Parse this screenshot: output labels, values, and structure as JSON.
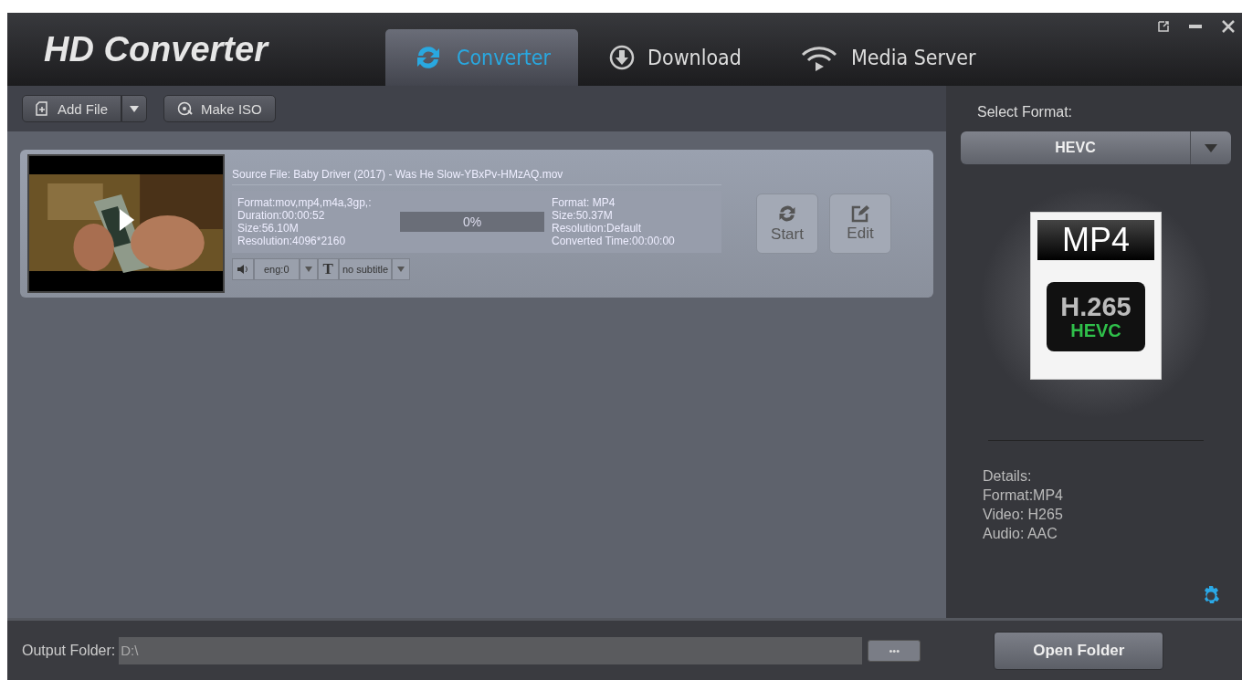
{
  "app": {
    "title": "HD Converter"
  },
  "tabs": [
    {
      "label": "Converter",
      "selected": true,
      "kind": "convert"
    },
    {
      "label": "Download",
      "selected": false,
      "kind": "download"
    },
    {
      "label": "Media Server",
      "selected": false,
      "kind": "server"
    }
  ],
  "toolbar": {
    "add_file": "Add File",
    "make_iso": "Make ISO"
  },
  "files": [
    {
      "kind": "picture",
      "source": "Source File: Baby Driver (2017) - Was He Slow-YBxPv-HMzAQ.mov",
      "input": [
        "Format:mov,mp4,m4a,3gp,:",
        "Duration:00:00:52",
        "Size:56.10M",
        "Resolution:4096*2160"
      ],
      "progress": {
        "level": 0,
        "reading": "0%"
      },
      "output": [
        "Format: MP4",
        "Size:50.37M",
        "Resolution:Default",
        "Converted Time:00:00:00"
      ],
      "audio": "eng:0",
      "subtitle_icon": "T",
      "subtitle": "no subtitle",
      "start": "Start",
      "edit": "Edit"
    }
  ],
  "format_panel": {
    "label": "Select Format:",
    "value": "HEVC",
    "badge": {
      "container": "MP4",
      "codec": "H.265",
      "name": "HEVC"
    },
    "details": [
      "Details:",
      "Format:MP4",
      "Video: H265",
      "Audio: AAC"
    ]
  },
  "output_folder": {
    "label": "Output Folder:",
    "value": "D:\\",
    "browse": "•••",
    "open": "Open Folder"
  }
}
